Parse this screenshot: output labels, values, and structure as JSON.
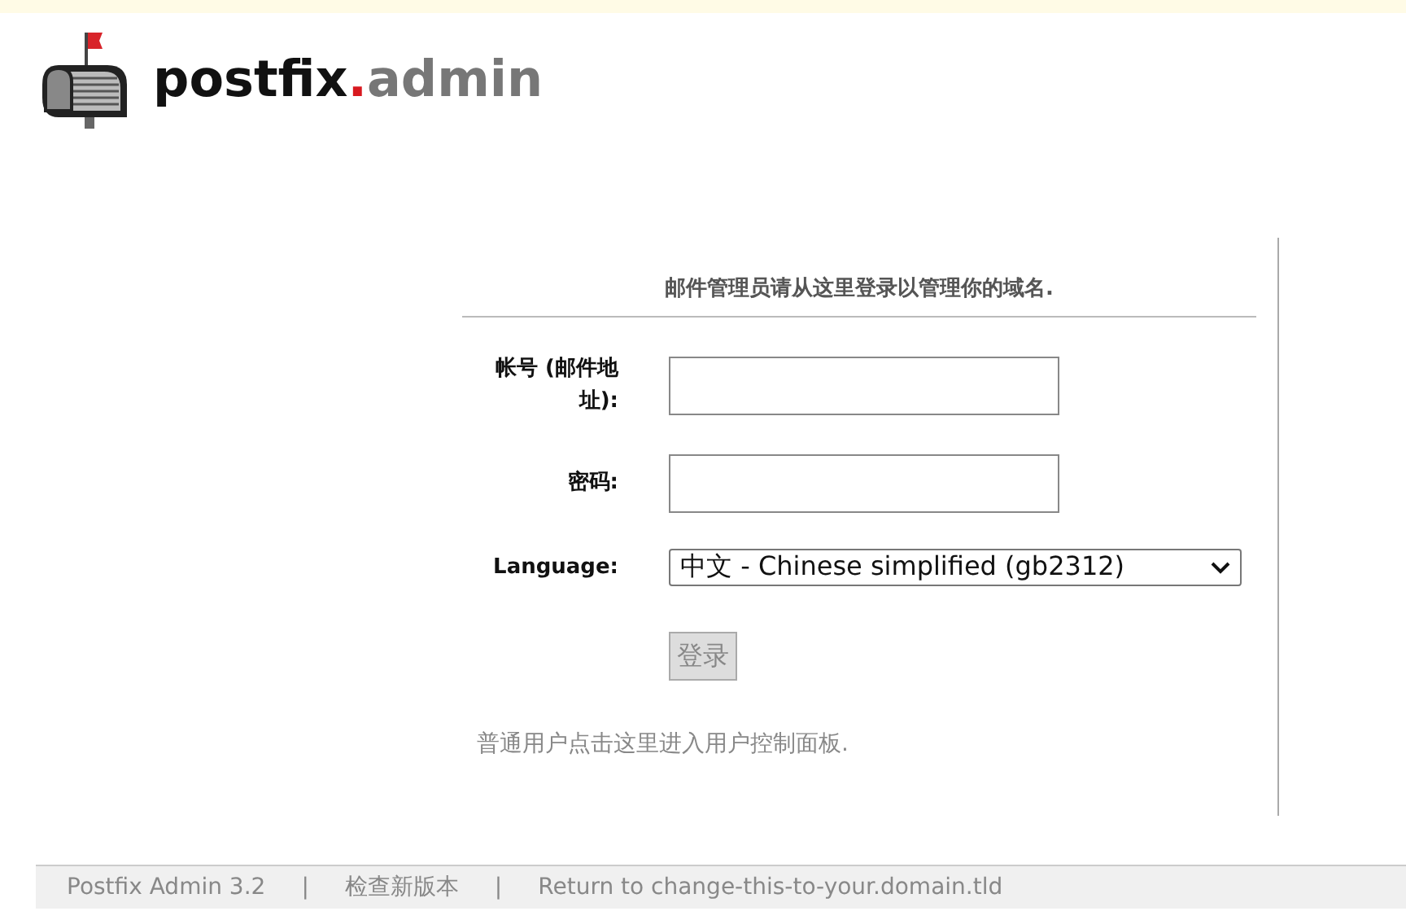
{
  "logo": {
    "brand": "postfix",
    "dot": ".",
    "suffix": "admin"
  },
  "login": {
    "title": "邮件管理员请从这里登录以管理你的域名.",
    "fields": [
      {
        "kind": "text",
        "label": "帐号 (邮件地址):"
      },
      {
        "kind": "password",
        "label": "密码:"
      },
      {
        "kind": "select",
        "label": "Language:",
        "value": "中文 - Chinese simplified (gb2312)"
      }
    ],
    "submit": "登录",
    "user_link": "普通用户点击这里进入用户控制面板."
  },
  "footer": [
    {
      "text": "Postfix Admin 3.2"
    },
    {
      "text": "检查新版本"
    },
    {
      "text": "Return to change-this-to-your.domain.tld"
    }
  ],
  "footer_separator": "|"
}
